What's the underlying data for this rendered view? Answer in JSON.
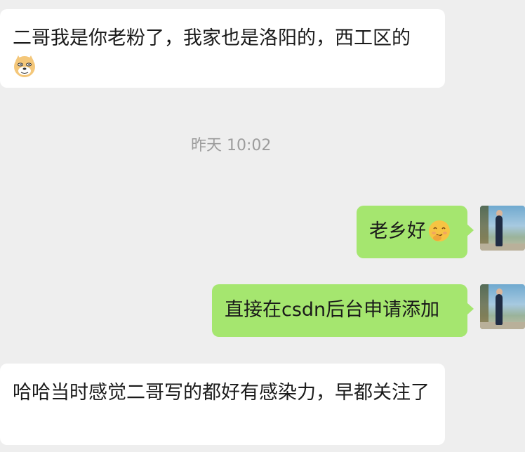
{
  "messages": [
    {
      "direction": "incoming",
      "text": "二哥我是你老粉了，我家也是洛阳的，西工区的",
      "emoji": "doge-icon"
    },
    {
      "type": "timestamp",
      "text": "昨天 10:02"
    },
    {
      "direction": "outgoing",
      "text": "老乡好",
      "emoji": "shy-smile-icon"
    },
    {
      "direction": "outgoing",
      "text": "直接在csdn后台申请添加"
    },
    {
      "direction": "incoming",
      "text": "哈哈当时感觉二哥写的都好有感染力，早都关注了"
    }
  ],
  "colors": {
    "background": "#eeeeee",
    "incoming_bubble": "#ffffff",
    "outgoing_bubble": "#a5e66f",
    "timestamp_text": "#9c9c9c"
  },
  "icons": {
    "avatar": "user-avatar-photo"
  }
}
